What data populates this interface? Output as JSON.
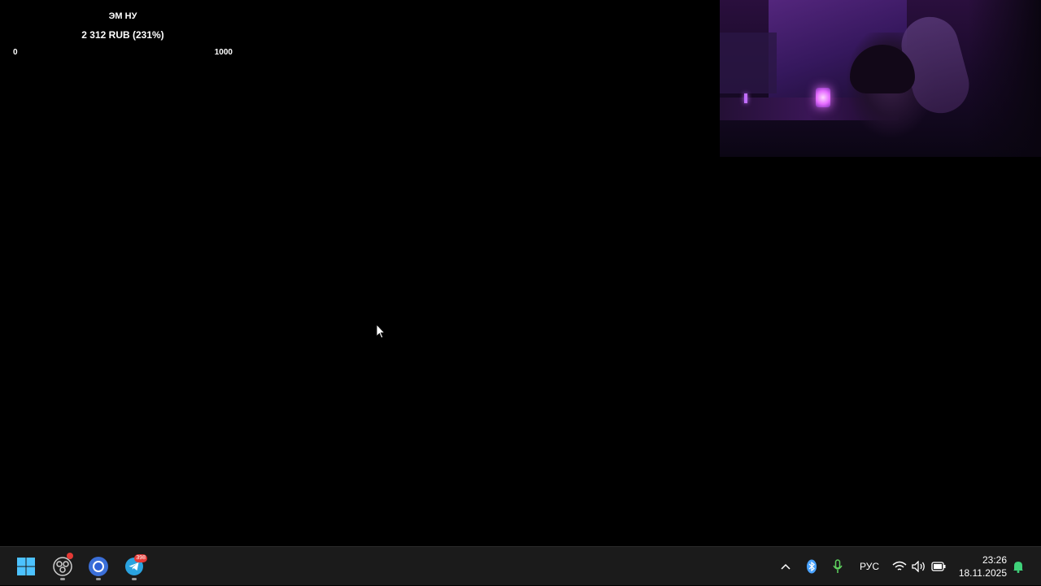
{
  "goal": {
    "title": "ЭМ НУ",
    "amount": "2 312 RUB (231%)",
    "min": "0",
    "max": "1000",
    "progress_percent": 231
  },
  "webcam": {
    "label": "webcam-overlay"
  },
  "taskbar": {
    "apps": [
      {
        "name": "start",
        "icon": "windows-start-icon"
      },
      {
        "name": "obs",
        "icon": "obs-icon",
        "badge": ""
      },
      {
        "name": "browser",
        "icon": "chrome-icon"
      },
      {
        "name": "telegram",
        "icon": "telegram-icon",
        "badge": "398"
      }
    ],
    "tray": {
      "language": "РУС",
      "time": "23:26",
      "date": "18.11.2025"
    }
  },
  "colors": {
    "taskbar_bg": "#1b1b1b",
    "badge": "#e53935",
    "mic_green": "#5fd35f",
    "bluetooth": "#4aa3ff",
    "notification_green": "#3fd27a"
  }
}
